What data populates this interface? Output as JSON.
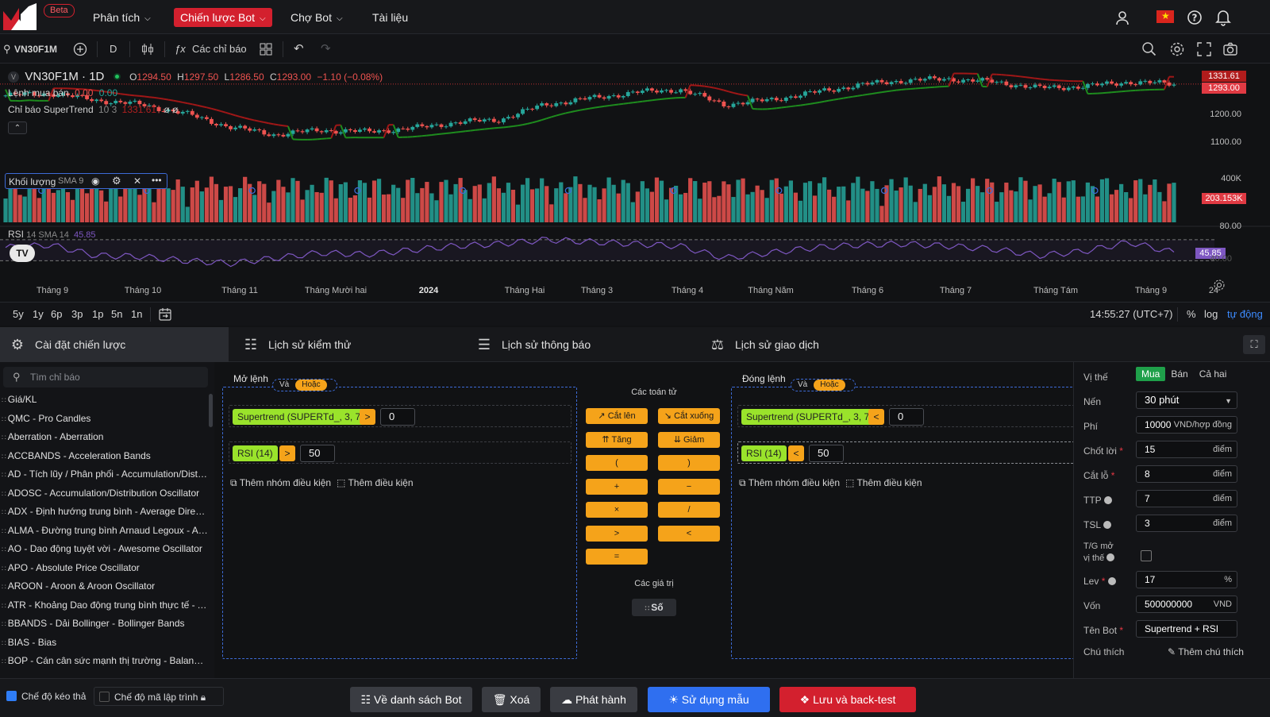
{
  "nav": {
    "beta": "Beta",
    "items": [
      {
        "label": "Phân tích",
        "has_caret": true,
        "active": false
      },
      {
        "label": "Chiến lược Bot",
        "has_caret": true,
        "active": true
      },
      {
        "label": "Chợ Bot",
        "has_caret": true,
        "active": false
      },
      {
        "label": "Tài liệu",
        "has_caret": false,
        "active": false
      }
    ]
  },
  "toolbar": {
    "symbol": "VN30F1M",
    "interval": "D",
    "indicators": "Các chỉ báo"
  },
  "chart": {
    "title": "VN30F1M · 1D",
    "ohlc": {
      "o_label": "O",
      "o": "1294.50",
      "h_label": "H",
      "h": "1297.50",
      "l_label": "L",
      "l": "1286.50",
      "c_label": "C",
      "c": "1293.00",
      "change": "−1.10 (−0.08%)"
    },
    "orders_label": "Lệnh mua bán",
    "orders_v1": "0.00",
    "orders_v2": "0.00",
    "supertrend_label": "Chỉ báo SuperTrend",
    "supertrend_params": "10 3",
    "supertrend_val": "1331.61",
    "supertrend_extra": "ø ø",
    "volume_label": "Khối lượng",
    "volume_sma": "SMA 9",
    "rsi_label": "RSI",
    "rsi_params": "14 SMA 14",
    "rsi_value": "45.85",
    "price_badge_top": "1331.61",
    "price_badge_last": "1293.00",
    "volume_badge": "203.153K",
    "rsi_badge": "45.85",
    "price_axis": [
      "1200.00",
      "1100.00"
    ],
    "volume_axis": "400K",
    "rsi_axis": [
      "80.00",
      "40.00"
    ],
    "months": [
      "Tháng 9",
      "Tháng 10",
      "Tháng 11",
      "Tháng Mười hai",
      "2024",
      "Tháng Hai",
      "Tháng 3",
      "Tháng 4",
      "Tháng Năm",
      "Tháng 6",
      "Tháng 7",
      "Tháng Tám",
      "Tháng 9",
      "24"
    ],
    "colors": {
      "up": "#26a69a",
      "down": "#ef5350",
      "supertrend_up": "#1e8c1e",
      "supertrend_down": "#a01717",
      "rsi": "#7e57c2"
    }
  },
  "chart_data": {
    "type": "candlestick",
    "title": "VN30F1M · 1D",
    "series": [
      {
        "name": "VN30F1M close (approx.)",
        "x": [
          "2023-08-15",
          "2023-09-01",
          "2023-09-15",
          "2023-10-01",
          "2023-10-15",
          "2023-11-01",
          "2023-11-15",
          "2023-12-01",
          "2023-12-15",
          "2024-01-01",
          "2024-01-15",
          "2024-02-01",
          "2024-02-15",
          "2024-03-01",
          "2024-03-15",
          "2024-04-01",
          "2024-04-15",
          "2024-05-01",
          "2024-05-15",
          "2024-06-01",
          "2024-06-15",
          "2024-07-01",
          "2024-07-15",
          "2024-08-01",
          "2024-08-15",
          "2024-09-01",
          "2024-09-15"
        ],
        "values": [
          1255,
          1262,
          1240,
          1225,
          1195,
          1150,
          1125,
          1140,
          1135,
          1145,
          1165,
          1175,
          1225,
          1245,
          1265,
          1275,
          1225,
          1240,
          1265,
          1290,
          1305,
          1310,
          1300,
          1280,
          1285,
          1300,
          1293
        ]
      },
      {
        "name": "RSI 14 (approx.)",
        "values": [
          55,
          60,
          40,
          38,
          30,
          25,
          35,
          45,
          42,
          50,
          58,
          62,
          70,
          66,
          62,
          58,
          35,
          45,
          55,
          60,
          62,
          58,
          52,
          40,
          48,
          65,
          45.85
        ]
      }
    ],
    "y_range": [
      1050,
      1340
    ],
    "rsi_range": [
      20,
      85
    ],
    "last_close": 1293.0,
    "supertrend": 1331.61,
    "volume_last": "203.153K"
  },
  "range": {
    "buttons": [
      "5y",
      "1y",
      "6p",
      "3p",
      "1p",
      "5n",
      "1n"
    ],
    "time": "14:55:27 (UTC+7)",
    "percent": "%",
    "log": "log",
    "auto": "tự động"
  },
  "tabs": [
    {
      "label": "Cài đặt chiến lược",
      "active": true
    },
    {
      "label": "Lịch sử kiểm thử",
      "active": false
    },
    {
      "label": "Lịch sử thông báo",
      "active": false
    },
    {
      "label": "Lịch sử giao dịch",
      "active": false
    }
  ],
  "left": {
    "search_placeholder": "Tìm chỉ báo",
    "indicators": [
      "Giá/KL",
      "QMC - Pro Candles",
      "Aberration - Aberration",
      "ACCBANDS - Acceleration Bands",
      "AD - Tích lũy / Phân phối - Accumulation/Distribution",
      "ADOSC - Accumulation/Distribution Oscillator",
      "ADX - Định hướng trung bình - Average Directional Index",
      "ALMA - Đường trung bình Arnaud Legoux - Arnaud Legoux",
      "AO - Dao động tuyệt vời - Awesome Oscillator",
      "APO - Absolute Price Oscillator",
      "AROON - Aroon & Aroon Oscillator",
      "ATR - Khoảng Dao động trung bình thực tế - Average True Range",
      "BBANDS - Dải Bollinger - Bollinger Bands",
      "BIAS - Bias",
      "BOP - Cán cân sức mạnh thị trường - Balance of Power"
    ]
  },
  "open": {
    "title": "Mở lệnh",
    "and": "Và",
    "or": "Hoặc",
    "rows": [
      {
        "indicator": "Supertrend (SUPERTd_, 3, 7)",
        "op": ">",
        "value": "0"
      },
      {
        "indicator": "RSI (14)",
        "op": ">",
        "value": "50"
      }
    ],
    "add_group": "Thêm nhóm điều kiện",
    "add_cond": "Thêm điều kiện"
  },
  "close": {
    "title": "Đóng lệnh",
    "and": "Và",
    "or": "Hoặc",
    "rows": [
      {
        "indicator": "Supertrend (SUPERTd_, 3, 7)",
        "op": "<",
        "value": "0"
      },
      {
        "indicator": "RSI (14)",
        "op": "<",
        "value": "50"
      }
    ],
    "add_group": "Thêm nhóm điều kiện",
    "add_cond": "Thêm điều kiện"
  },
  "operators": {
    "title": "Các toán tử",
    "buttons": [
      "Cắt lên",
      "Cắt xuống",
      "Tăng",
      "Giảm",
      "(",
      ")",
      "+",
      "−",
      "×",
      "/",
      ">",
      "<",
      "="
    ],
    "values_title": "Các giá trị",
    "number": "Số"
  },
  "params": {
    "position_label": "Vị thế",
    "position_options": [
      "Mua",
      "Bán",
      "Cả hai"
    ],
    "candle_label": "Nến",
    "candle_value": "30 phút",
    "fee_label": "Phí",
    "fee_value": "10000",
    "fee_unit": "VND/hợp đồng",
    "tp_label": "Chốt lời",
    "tp_value": "15",
    "sl_label": "Cắt lỗ",
    "sl_value": "8",
    "ttp_label": "TTP",
    "ttp_value": "7",
    "tsl_label": "TSL",
    "tsl_value": "3",
    "point_unit": "điểm",
    "open_time_label_1": "T/G mở",
    "open_time_label_2": "vị thế",
    "lev_label": "Lev",
    "lev_value": "17",
    "lev_unit": "%",
    "capital_label": "Vốn",
    "capital_value": "500000000",
    "capital_unit": "VND",
    "botname_label": "Tên Bot",
    "botname_value": "Supertrend + RSI",
    "note_label": "Chú thích",
    "note_add": "Thêm chú thích",
    "required": "*"
  },
  "bottom": {
    "drag_mode": "Chế độ kéo thả",
    "code_mode": "Chế độ mã lập trình",
    "back": "Về danh sách Bot",
    "delete": "Xoá",
    "publish": "Phát hành",
    "template": "Sử dụng mẫu",
    "save": "Lưu và back-test"
  }
}
